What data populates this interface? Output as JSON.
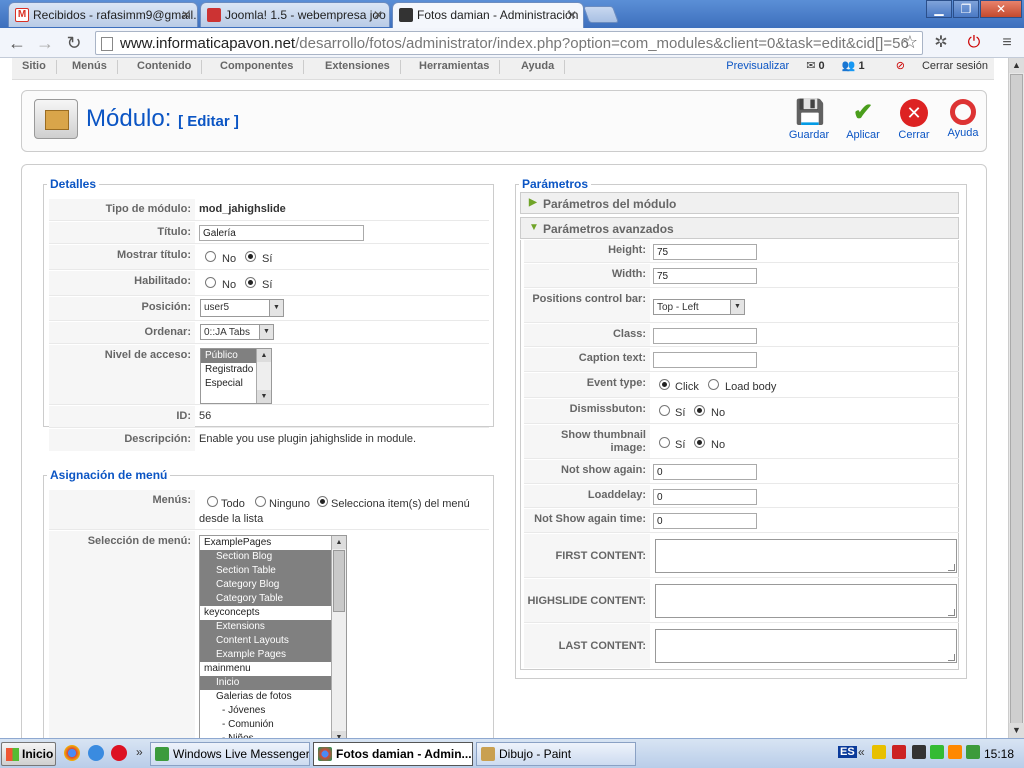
{
  "browser": {
    "tabs": [
      {
        "title": "Recibidos - rafasimm9@gmail.",
        "color": "#d93025"
      },
      {
        "title": "Joomla! 1.5 - webempresa joo",
        "color": "#cc3333"
      },
      {
        "title": "Fotos damian - Administración",
        "color": "#2a2a2a"
      }
    ],
    "url_host": "www.informaticapavon.net",
    "url_path": "/desarrollo/fotos/administrator/index.php?option=com_modules&client=0&task=edit&cid[]=56"
  },
  "menubar": {
    "items": [
      "Sitio",
      "Menús",
      "Contenido",
      "Componentes",
      "Extensiones",
      "Herramientas",
      "Ayuda"
    ]
  },
  "status": {
    "preview": "Previsualizar",
    "messages": "0",
    "users": "1",
    "logout": "Cerrar sesión"
  },
  "header": {
    "title": "Módulo:",
    "subtitle": "[ Editar ]",
    "buttons": [
      {
        "label": "Guardar"
      },
      {
        "label": "Aplicar"
      },
      {
        "label": "Cerrar"
      },
      {
        "label": "Ayuda"
      }
    ]
  },
  "details": {
    "legend": "Detalles",
    "type_label": "Tipo de módulo:",
    "type_value": "mod_jahighslide",
    "title_label": "Título:",
    "title_value": "Galería",
    "showtitle_label": "Mostrar título:",
    "enabled_label": "Habilitado:",
    "no": "No",
    "si": "Sí",
    "position_label": "Posición:",
    "position_value": "user5",
    "order_label": "Ordenar:",
    "order_value": "0::JA Tabs",
    "access_label": "Nivel de acceso:",
    "access_options": [
      "Público",
      "Registrado",
      "Especial"
    ],
    "id_label": "ID:",
    "id_value": "56",
    "desc_label": "Descripción:",
    "desc_value": "Enable you use plugin jahighslide in module."
  },
  "menu_assign": {
    "legend": "Asignación de menú",
    "menus_label": "Menús:",
    "opt_all": "Todo",
    "opt_none": "Ninguno",
    "opt_select": "Selecciona item(s) del menú",
    "opt_select2": "desde la lista",
    "selection_label": "Selección de menú:",
    "items": [
      {
        "text": "ExamplePages",
        "sel": false,
        "indent": 0
      },
      {
        "text": "Section Blog",
        "sel": true,
        "indent": 1
      },
      {
        "text": "Section Table",
        "sel": true,
        "indent": 1
      },
      {
        "text": "Category Blog",
        "sel": true,
        "indent": 1
      },
      {
        "text": "Category Table",
        "sel": true,
        "indent": 1
      },
      {
        "text": "keyconcepts",
        "sel": false,
        "indent": 0
      },
      {
        "text": "Extensions",
        "sel": true,
        "indent": 1
      },
      {
        "text": "Content Layouts",
        "sel": true,
        "indent": 1
      },
      {
        "text": "Example Pages",
        "sel": true,
        "indent": 1
      },
      {
        "text": "mainmenu",
        "sel": false,
        "indent": 0
      },
      {
        "text": "Inicio",
        "sel": true,
        "indent": 1
      },
      {
        "text": "Galerias de fotos",
        "sel": false,
        "indent": 1
      },
      {
        "text": "- Jóvenes",
        "sel": false,
        "indent": 2
      },
      {
        "text": "- Comunión",
        "sel": false,
        "indent": 2
      },
      {
        "text": "- Niños",
        "sel": false,
        "indent": 2
      }
    ]
  },
  "params": {
    "legend": "Parámetros",
    "pane_module": "Parámetros del módulo",
    "pane_advanced": "Parámetros avanzados",
    "height_label": "Height:",
    "height_value": "75",
    "width_label": "Width:",
    "width_value": "75",
    "pos_label": "Positions control bar:",
    "pos_value": "Top - Left",
    "class_label": "Class:",
    "caption_label": "Caption text:",
    "event_label": "Event type:",
    "event_click": "Click",
    "event_load": "Load body",
    "dismiss_label": "Dismissbuton:",
    "thumb_label": "Show thumbnail image:",
    "si": "Sí",
    "no": "No",
    "notshow_label": "Not show again:",
    "notshow_value": "0",
    "loaddelay_label": "Loaddelay:",
    "loaddelay_value": "0",
    "notshowtime_label": "Not Show again time:",
    "notshowtime_value": "0",
    "first_label": "FIRST CONTENT:",
    "highslide_label": "HIGHSLIDE CONTENT:",
    "last_label": "LAST CONTENT:"
  },
  "taskbar": {
    "start": "Inicio",
    "tasks": [
      {
        "label": "Windows Live Messenger"
      },
      {
        "label": "Fotos damian - Admin..."
      },
      {
        "label": "Dibujo - Paint"
      }
    ],
    "lang": "ES",
    "clock": "15:18"
  }
}
